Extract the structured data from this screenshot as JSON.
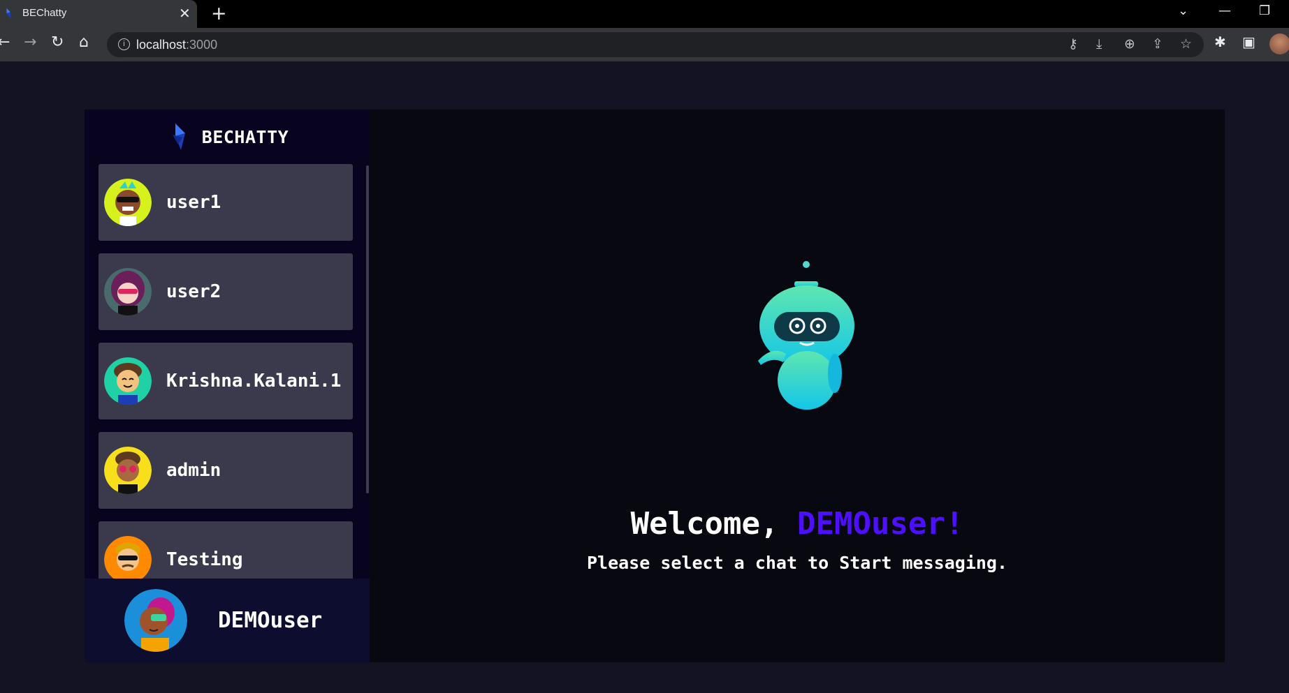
{
  "browser": {
    "tab_title": "BEChatty",
    "tab_close": "✕",
    "new_tab": "+",
    "url_host": "localhost",
    "url_port": ":3000",
    "icons": {
      "back": "arrow-left-icon",
      "forward": "arrow-right-icon",
      "reload": "reload-icon",
      "home": "home-icon",
      "info": "info-icon",
      "key": "key-icon",
      "install": "install-icon",
      "zoom": "zoom-icon",
      "share": "share-icon",
      "bookmark": "star-icon",
      "extensions": "puzzle-icon",
      "side_panel": "side-panel-icon"
    }
  },
  "app": {
    "brand": "BECHATTY",
    "accent_color": "#4e0eff",
    "contacts": [
      {
        "name": "user1",
        "avatar": "avatar-sunglasses-mohawk"
      },
      {
        "name": "user2",
        "avatar": "avatar-purple-hair"
      },
      {
        "name": "Krishna.Kalani.1",
        "avatar": "avatar-curly-hair"
      },
      {
        "name": "admin",
        "avatar": "avatar-pink-glasses"
      },
      {
        "name": "Testing",
        "avatar": "avatar-orange-sunglasses"
      }
    ],
    "current_user": {
      "name": "DEMOuser",
      "avatar": "avatar-cyborg"
    },
    "welcome": {
      "greeting": "Welcome,",
      "username": "DEMOuser!",
      "subtitle": "Please select a chat to Start messaging."
    }
  }
}
